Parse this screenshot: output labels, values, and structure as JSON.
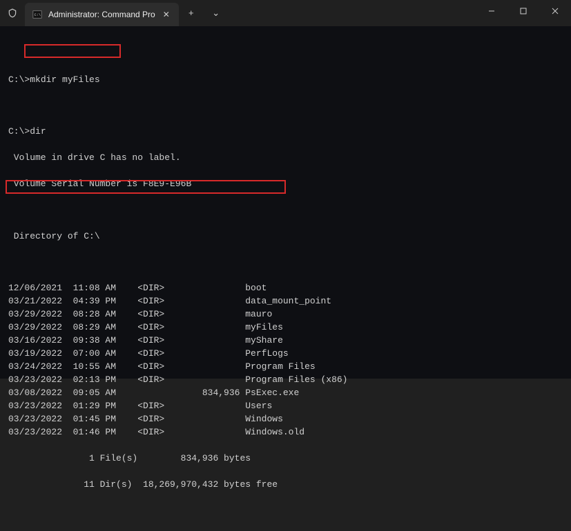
{
  "window": {
    "tab_title": "Administrator: Command Pro",
    "new_tab_label": "+",
    "tab_menu_label": "⌄",
    "minimize": "—",
    "maximize": "☐",
    "close": "✕",
    "tab_close": "✕"
  },
  "colors": {
    "highlight": "#d82a2a",
    "terminal_bg": "#0e0f13",
    "text": "#d0d0d0"
  },
  "cmd1": {
    "prompt": "C:\\>",
    "command": "mkdir myFiles"
  },
  "cmd2": {
    "prompt": "C:\\>",
    "command": "dir"
  },
  "volume_label_line": " Volume in drive C has no label.",
  "volume_serial_line": " Volume Serial Number is F8E9-E96B",
  "directory_of_line": " Directory of C:\\",
  "listing": [
    {
      "date": "12/06/2021",
      "time": "11:08 AM",
      "type": "<DIR>",
      "size": "",
      "name": "boot"
    },
    {
      "date": "03/21/2022",
      "time": "04:39 PM",
      "type": "<DIR>",
      "size": "",
      "name": "data_mount_point"
    },
    {
      "date": "03/29/2022",
      "time": "08:28 AM",
      "type": "<DIR>",
      "size": "",
      "name": "mauro"
    },
    {
      "date": "03/29/2022",
      "time": "08:29 AM",
      "type": "<DIR>",
      "size": "",
      "name": "myFiles"
    },
    {
      "date": "03/16/2022",
      "time": "09:38 AM",
      "type": "<DIR>",
      "size": "",
      "name": "myShare"
    },
    {
      "date": "03/19/2022",
      "time": "07:00 AM",
      "type": "<DIR>",
      "size": "",
      "name": "PerfLogs"
    },
    {
      "date": "03/24/2022",
      "time": "10:55 AM",
      "type": "<DIR>",
      "size": "",
      "name": "Program Files"
    },
    {
      "date": "03/23/2022",
      "time": "02:13 PM",
      "type": "<DIR>",
      "size": "",
      "name": "Program Files (x86)"
    },
    {
      "date": "03/08/2022",
      "time": "09:05 AM",
      "type": "",
      "size": "834,936",
      "name": "PsExec.exe"
    },
    {
      "date": "03/23/2022",
      "time": "01:29 PM",
      "type": "<DIR>",
      "size": "",
      "name": "Users"
    },
    {
      "date": "03/23/2022",
      "time": "01:45 PM",
      "type": "<DIR>",
      "size": "",
      "name": "Windows"
    },
    {
      "date": "03/23/2022",
      "time": "01:46 PM",
      "type": "<DIR>",
      "size": "",
      "name": "Windows.old"
    }
  ],
  "summary": {
    "files_line": "               1 File(s)        834,936 bytes",
    "dirs_line": "              11 Dir(s)  18,269,970,432 bytes free"
  }
}
